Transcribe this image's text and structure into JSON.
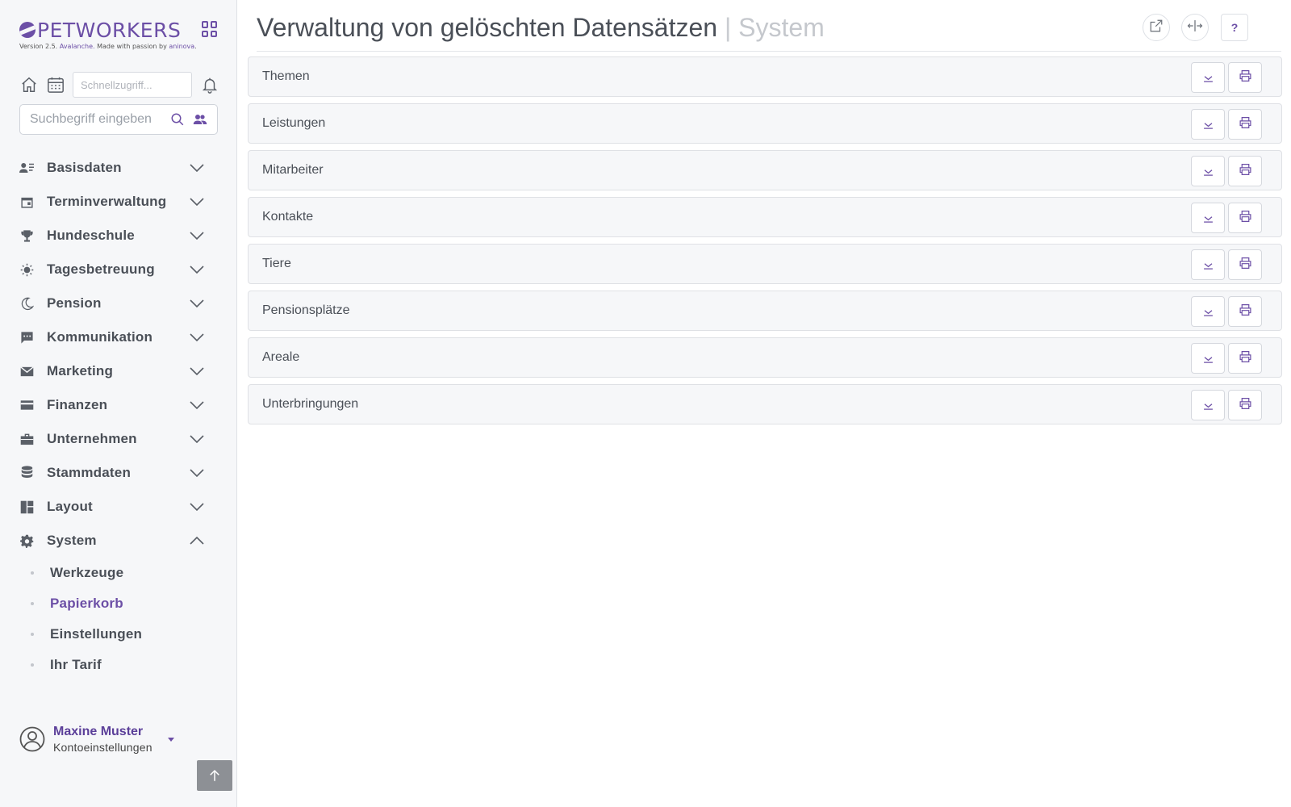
{
  "brand": {
    "name": "PETWORKERS",
    "version_prefix": "Version 2.5.",
    "version_name": "Avalanche.",
    "version_suffix": "Made with passion by",
    "company": "aninova",
    "company_end": "."
  },
  "toolbar": {
    "quick_placeholder": "Schnellzugriff..."
  },
  "search": {
    "placeholder": "Suchbegriff eingeben"
  },
  "nav": {
    "items": [
      {
        "label": "Basisdaten",
        "icon": "person-card-icon"
      },
      {
        "label": "Terminverwaltung",
        "icon": "calendar-icon"
      },
      {
        "label": "Hundeschule",
        "icon": "trophy-icon"
      },
      {
        "label": "Tagesbetreuung",
        "icon": "sun-icon"
      },
      {
        "label": "Pension",
        "icon": "moon-icon"
      },
      {
        "label": "Kommunikation",
        "icon": "chat-icon"
      },
      {
        "label": "Marketing",
        "icon": "mail-icon"
      },
      {
        "label": "Finanzen",
        "icon": "credit-card-icon"
      },
      {
        "label": "Unternehmen",
        "icon": "briefcase-icon"
      },
      {
        "label": "Stammdaten",
        "icon": "database-icon"
      },
      {
        "label": "Layout",
        "icon": "layout-icon"
      },
      {
        "label": "System",
        "icon": "gear-icon",
        "expanded": true
      }
    ],
    "system_sub": [
      {
        "label": "Werkzeuge"
      },
      {
        "label": "Papierkorb",
        "active": true
      },
      {
        "label": "Einstellungen"
      },
      {
        "label": "Ihr Tarif"
      }
    ]
  },
  "user": {
    "name": "Maxine Muster",
    "account_label": "Kontoeinstellungen"
  },
  "header": {
    "title": "Verwaltung von gelöschten Datensätzen",
    "separator": "|",
    "section": "System",
    "help_label": "?"
  },
  "panels": [
    {
      "title": "Themen"
    },
    {
      "title": "Leistungen"
    },
    {
      "title": "Mitarbeiter"
    },
    {
      "title": "Kontakte"
    },
    {
      "title": "Tiere"
    },
    {
      "title": "Pensionsplätze"
    },
    {
      "title": "Areale"
    },
    {
      "title": "Unterbringungen"
    }
  ],
  "colors": {
    "accent": "#6c4fa6",
    "sidebar_bg": "#f6f7f9",
    "text": "#4a4f57"
  }
}
